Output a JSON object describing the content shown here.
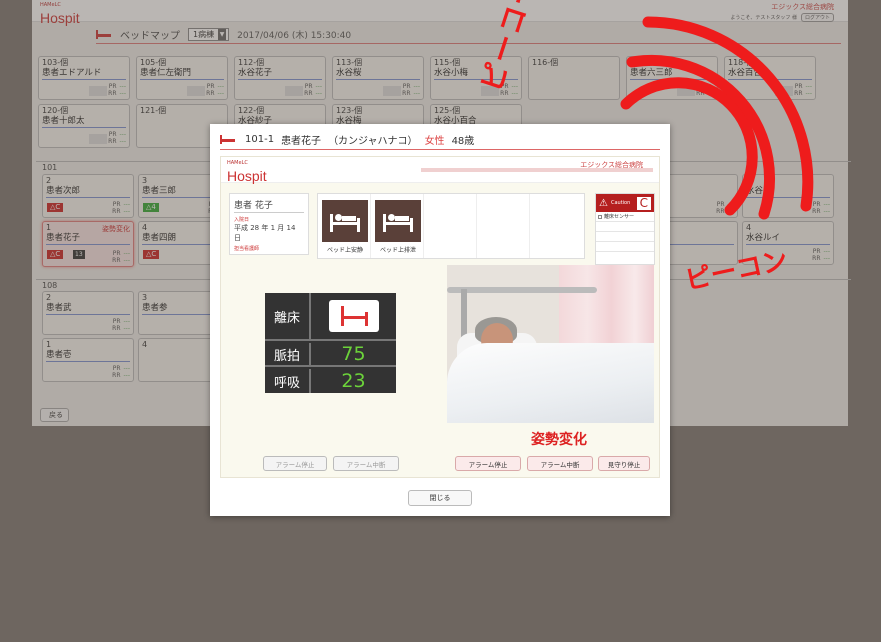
{
  "app": {
    "brand_sub": "HAMeLC",
    "brand_name": "Hospit",
    "hospital_name": "エジックス総合病院",
    "welcome": "ようこそ、テストスタッフ 様",
    "logout_label": "ログアウト",
    "title": "ベッドマップ",
    "ward_selected": "1病棟",
    "datetime": "2017/04/06 (木) 15:30:40",
    "back_label": "戻る"
  },
  "cards_top": [
    {
      "num": "103-個",
      "name": "患者エドアルド"
    },
    {
      "num": "105-個",
      "name": "患者仁左衛門"
    },
    {
      "num": "112-個",
      "name": "水谷花子"
    },
    {
      "num": "113-個",
      "name": "水谷桜"
    },
    {
      "num": "115-個",
      "name": "水谷小梅"
    },
    {
      "num": "116-個",
      "name": ""
    },
    {
      "num": "117-個",
      "name": "患者六三郎"
    },
    {
      "num": "118-個",
      "name": "水谷百合"
    },
    {
      "num": "120-個",
      "name": "患者十郎太"
    },
    {
      "num": "121-個",
      "name": ""
    },
    {
      "num": "122-個",
      "name": "水谷紗子"
    },
    {
      "num": "123-個",
      "name": "水谷梅"
    },
    {
      "num": "125-個",
      "name": "水谷小百合"
    }
  ],
  "group_101": {
    "label": "101",
    "cards": [
      {
        "num": "2",
        "name": "患者次郎",
        "caution": "△C"
      },
      {
        "num": "3",
        "name": "患者三郎",
        "caution": "△4"
      },
      {
        "num": "1",
        "name": "患者花子",
        "caution": "△C",
        "badge": "13",
        "status": "姿勢変化"
      },
      {
        "num": "4",
        "name": "患者四朗",
        "caution": "△C"
      },
      {
        "num": "3",
        "name": "水谷"
      },
      {
        "num": "4",
        "name": "水谷ルイ"
      },
      {
        "num": "",
        "name": "愛"
      }
    ]
  },
  "group_108": {
    "label": "108",
    "cards": [
      {
        "num": "2",
        "name": "患者武"
      },
      {
        "num": "3",
        "name": "患者参"
      },
      {
        "num": "1",
        "name": "患者壱"
      },
      {
        "num": "4",
        "name": ""
      }
    ]
  },
  "vital_labels": {
    "pr": "PR",
    "rr": "RR",
    "dash": "---"
  },
  "modal": {
    "bed": "101-1",
    "patient_name": "患者花子",
    "kana": "（カンジャハナコ）",
    "gender": "女性",
    "age": "48歳",
    "inner_brand_sub": "HAMeLC",
    "inner_brand_name": "Hospit",
    "inner_hospital": "エジックス総合病院",
    "info_name": "患者 花子",
    "admission_label": "入院日",
    "admission_date": "平成 28 年 1 月 14 日",
    "doctor_label": "担当看護師",
    "sensor1": "ベッド上安静",
    "sensor2": "ベッド上排泄",
    "caution_word": "Caution",
    "caution_letter": "C",
    "caution_item": "離床センサー",
    "vitals": [
      {
        "label": "離床",
        "value": ""
      },
      {
        "label": "脈拍",
        "value": "75"
      },
      {
        "label": "呼吸",
        "value": "23"
      }
    ],
    "posture": "姿勢変化",
    "left_buttons": [
      "アラーム停止",
      "アラーム中断"
    ],
    "right_buttons": [
      "アラーム停止",
      "アラーム中断",
      "見守り停止"
    ],
    "close_label": "閉じる"
  },
  "sfx": {
    "text1": "ピーコー",
    "text2": "ピーコン",
    "color": "#ee1c1c"
  }
}
